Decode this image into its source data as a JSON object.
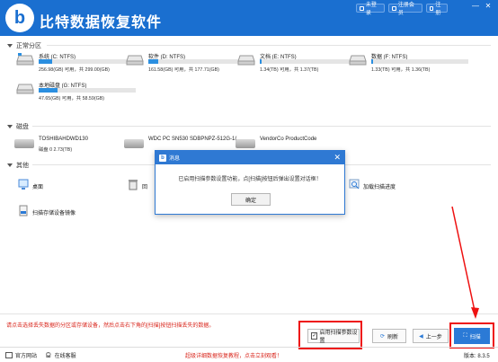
{
  "app": {
    "title": "比特数据恢复软件",
    "logo_letter": "b"
  },
  "header_buttons": {
    "login": "未登录",
    "register": "注册会员",
    "activate": "注册"
  },
  "window_controls": {
    "minimize": "—",
    "close": "✕"
  },
  "sections": {
    "partitions": "正常分区",
    "disks": "磁盘",
    "others": "其他"
  },
  "partitions": [
    {
      "name": "系统 (C: NTFS)",
      "size": "256.98(GB) 可用，共 299.00(GB)",
      "fill_pct": 14
    },
    {
      "name": "软件 (D: NTFS)",
      "size": "161.58(GB) 可用，共 177.71(GB)",
      "fill_pct": 10
    },
    {
      "name": "文档 (E: NTFS)",
      "size": "1.34(TB) 可用，共 1.37(TB)",
      "fill_pct": 2
    },
    {
      "name": "数据 (F: NTFS)",
      "size": "1.33(TB) 可用，共 1.36(TB)",
      "fill_pct": 2
    },
    {
      "name": "本地磁盘 (G: NTFS)",
      "size": "47.65(GB) 可用，共 58.59(GB)",
      "fill_pct": 19
    }
  ],
  "disks": [
    {
      "name": "TOSHIBAHDWD130",
      "size": "磁盘 0   2.73(TB)"
    },
    {
      "name": "WDC PC SN530 SDBPNPZ-512G-1(",
      "size": ""
    },
    {
      "name": "VendorCo ProductCode",
      "size": ""
    }
  ],
  "others": [
    {
      "label": "桌面",
      "icon": "desktop-icon"
    },
    {
      "label": "回",
      "icon": "recycle-bin-icon"
    },
    {
      "label": "加载扫描进度",
      "icon": "load-scan-icon"
    },
    {
      "label": "扫描存储设备镜像",
      "icon": "image-file-icon"
    }
  ],
  "modal": {
    "title": "消息",
    "message": "已启用扫描参数设置功能，点[扫描]按钮后弹出设置对话框！",
    "ok": "确定"
  },
  "footer": {
    "tip": "请点击选择丢失数据的分区或存储设备，然后点击右下角的[扫描]按钮扫描丢失的数据。",
    "checkbox_label": "启用扫描参数设置",
    "checkbox_checked": true,
    "refresh": "刷新",
    "back": "上一步",
    "scan": "扫描"
  },
  "statusbar": {
    "website": "官方网站",
    "support": "在线客服",
    "promo": "超级详细数据恢复教程，点击立刻观看！",
    "version": "版本: 8.3.5"
  },
  "colors": {
    "brand": "#1a6fd0",
    "accent": "#2b7ad6",
    "tip_red": "#d9261c",
    "highlight_red": "#e11111"
  }
}
